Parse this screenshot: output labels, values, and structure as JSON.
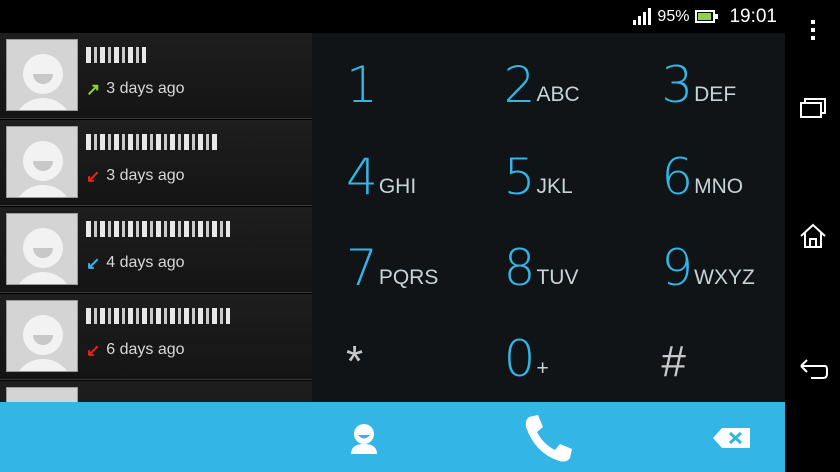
{
  "status_bar": {
    "battery_percent": "95%",
    "time": "19:01",
    "signal_bars": 4
  },
  "call_log": [
    {
      "call_type": "outgoing",
      "time_ago": "3 days ago"
    },
    {
      "call_type": "missed",
      "time_ago": "3 days ago"
    },
    {
      "call_type": "incoming",
      "time_ago": "4 days ago"
    },
    {
      "call_type": "missed",
      "time_ago": "6 days ago"
    }
  ],
  "dialpad": {
    "keys": [
      {
        "digit": "1",
        "letters": ""
      },
      {
        "digit": "2",
        "letters": "ABC"
      },
      {
        "digit": "3",
        "letters": "DEF"
      },
      {
        "digit": "4",
        "letters": "GHI"
      },
      {
        "digit": "5",
        "letters": "JKL"
      },
      {
        "digit": "6",
        "letters": "MNO"
      },
      {
        "digit": "7",
        "letters": "PQRS"
      },
      {
        "digit": "8",
        "letters": "TUV"
      },
      {
        "digit": "9",
        "letters": "WXYZ"
      },
      {
        "digit": "*",
        "letters": ""
      },
      {
        "digit": "0",
        "letters": "+"
      },
      {
        "digit": "#",
        "letters": ""
      }
    ]
  },
  "action_bar": {
    "icons": [
      "contacts-icon",
      "phone-icon",
      "backspace-icon"
    ]
  },
  "nav_bar": {
    "icons": [
      "menu-icon",
      "recent-apps-icon",
      "home-icon",
      "back-icon"
    ]
  },
  "colors": {
    "accent": "#33b5e5",
    "outgoing": "#8ccf3a",
    "missed": "#e0251d",
    "incoming": "#33b5e5"
  }
}
